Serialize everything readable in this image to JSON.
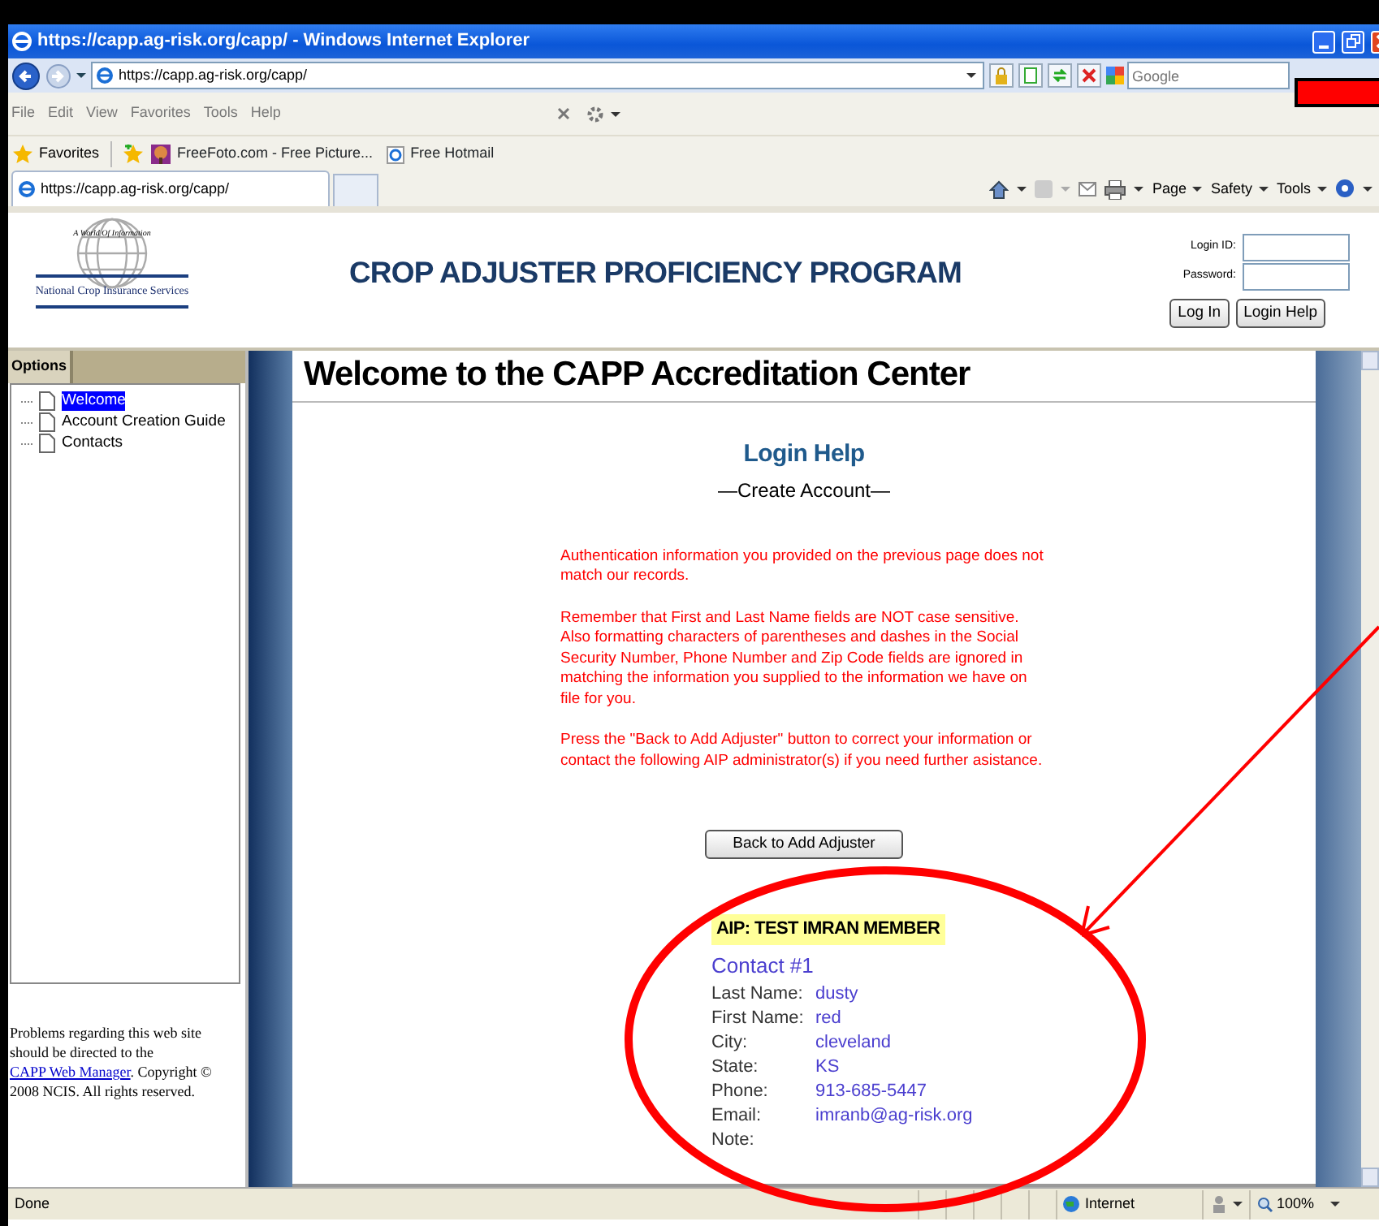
{
  "window": {
    "title": "https://capp.ag-risk.org/capp/ - Windows Internet Explorer"
  },
  "address_bar": {
    "url": "https://capp.ag-risk.org/capp/",
    "search_placeholder": "Google"
  },
  "menu": [
    "File",
    "Edit",
    "View",
    "Favorites",
    "Tools",
    "Help"
  ],
  "favorites_bar": {
    "label": "Favorites",
    "links": [
      "FreeFoto.com - Free Picture...",
      "Free Hotmail"
    ]
  },
  "tab": {
    "label": "https://capp.ag-risk.org/capp/"
  },
  "command_bar": [
    "Page",
    "Safety",
    "Tools"
  ],
  "page": {
    "logo": {
      "tagline": "A World Of Information",
      "name": "National Crop Insurance Services"
    },
    "title": "CROP ADJUSTER PROFICIENCY PROGRAM",
    "login": {
      "fields": [
        "Login ID:",
        "Password:"
      ],
      "buttons": [
        "Log In",
        "Login Help"
      ]
    }
  },
  "sidebar": {
    "tab": "Options",
    "items": [
      {
        "label": "Welcome",
        "selected": true
      },
      {
        "label": "Account Creation Guide",
        "selected": false
      },
      {
        "label": "Contacts",
        "selected": false
      }
    ],
    "footer": "Problems regarding this web site should be directed to the ",
    "footer_link": "CAPP Web Manager",
    "footer_after": ". Copyright © 2008 NCIS. All rights reserved."
  },
  "main": {
    "heading": "Welcome to the CAPP Accreditation Center",
    "section_title": "Login Help",
    "subtitle": "—Create Account—",
    "messages": [
      "Authentication information you provided on the previous page does not match our records.",
      "Remember that First and Last Name fields are NOT case sensitive. Also formatting characters of parentheses and dashes in the Social Security Number, Phone Number and Zip Code fields are ignored in matching the information you supplied to the information we have on file for you.",
      "Press the \"Back to Add Adjuster\" button to correct your information or contact the following AIP administrator(s) if you need further asistance."
    ],
    "back_button": "Back to Add Adjuster",
    "aip": "AIP: TEST IMRAN MEMBER",
    "contact_title": "Contact #1",
    "fields": [
      {
        "label": "Last Name:",
        "value": "dusty"
      },
      {
        "label": "First Name:",
        "value": "red"
      },
      {
        "label": "City:",
        "value": "cleveland"
      },
      {
        "label": "State:",
        "value": "KS"
      },
      {
        "label": "Phone:",
        "value": "913-685-5447"
      },
      {
        "label": "Email:",
        "value": "imranb@ag-risk.org"
      },
      {
        "label": "Note:"
      }
    ]
  },
  "status_bar": {
    "text": "Done",
    "zone": "Internet",
    "zoom": "100%"
  }
}
